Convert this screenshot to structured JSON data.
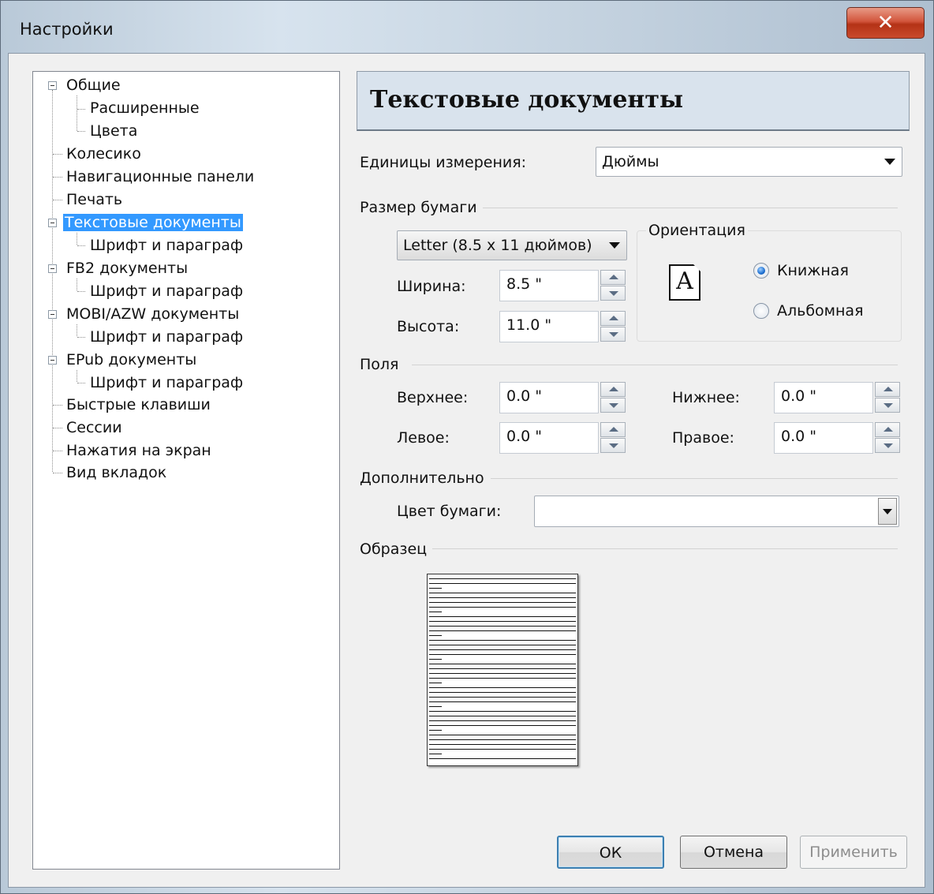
{
  "window": {
    "title": "Настройки"
  },
  "tree": {
    "items": [
      {
        "label": "Общие"
      },
      {
        "label": "Расширенные"
      },
      {
        "label": "Цвета"
      },
      {
        "label": "Колесико"
      },
      {
        "label": "Навигационные панели"
      },
      {
        "label": "Печать"
      },
      {
        "label": "Текстовые документы",
        "selected": true
      },
      {
        "label": "Шрифт и параграф"
      },
      {
        "label": "FB2 документы"
      },
      {
        "label": "Шрифт и параграф"
      },
      {
        "label": "MOBI/AZW документы"
      },
      {
        "label": "Шрифт и параграф"
      },
      {
        "label": "EPub документы"
      },
      {
        "label": "Шрифт и параграф"
      },
      {
        "label": "Быстрые клавиши"
      },
      {
        "label": "Сессии"
      },
      {
        "label": "Нажатия на экран"
      },
      {
        "label": "Вид вкладок"
      }
    ]
  },
  "panel": {
    "title": "Текстовые документы",
    "units_label": "Единицы измерения:",
    "units_value": "Дюймы",
    "paper_size_section": "Размер бумаги",
    "paper_size_value": "Letter (8.5 x 11 дюймов)",
    "width_label": "Ширина:",
    "width_value": "8.5 \"",
    "height_label": "Высота:",
    "height_value": "11.0 \"",
    "orientation_title": "Ориентация",
    "orientation_icon_letter": "A",
    "portrait_label": "Книжная",
    "landscape_label": "Альбомная",
    "orientation_selected": "portrait",
    "margins_section": "Поля",
    "top_label": "Верхнее:",
    "top_value": "0.0 \"",
    "bottom_label": "Нижнее:",
    "bottom_value": "0.0 \"",
    "left_label": "Левое:",
    "left_value": "0.0 \"",
    "right_label": "Правое:",
    "right_value": "0.0 \"",
    "extra_section": "Дополнительно",
    "paper_color_label": "Цвет бумаги:",
    "paper_color_value": "",
    "sample_section": "Образец"
  },
  "buttons": {
    "ok": "ОК",
    "cancel": "Отмена",
    "apply": "Применить"
  },
  "colors": {
    "selection": "#3399ff",
    "close_button": "#c94a2c",
    "header_bg": "#d9e3ed"
  }
}
